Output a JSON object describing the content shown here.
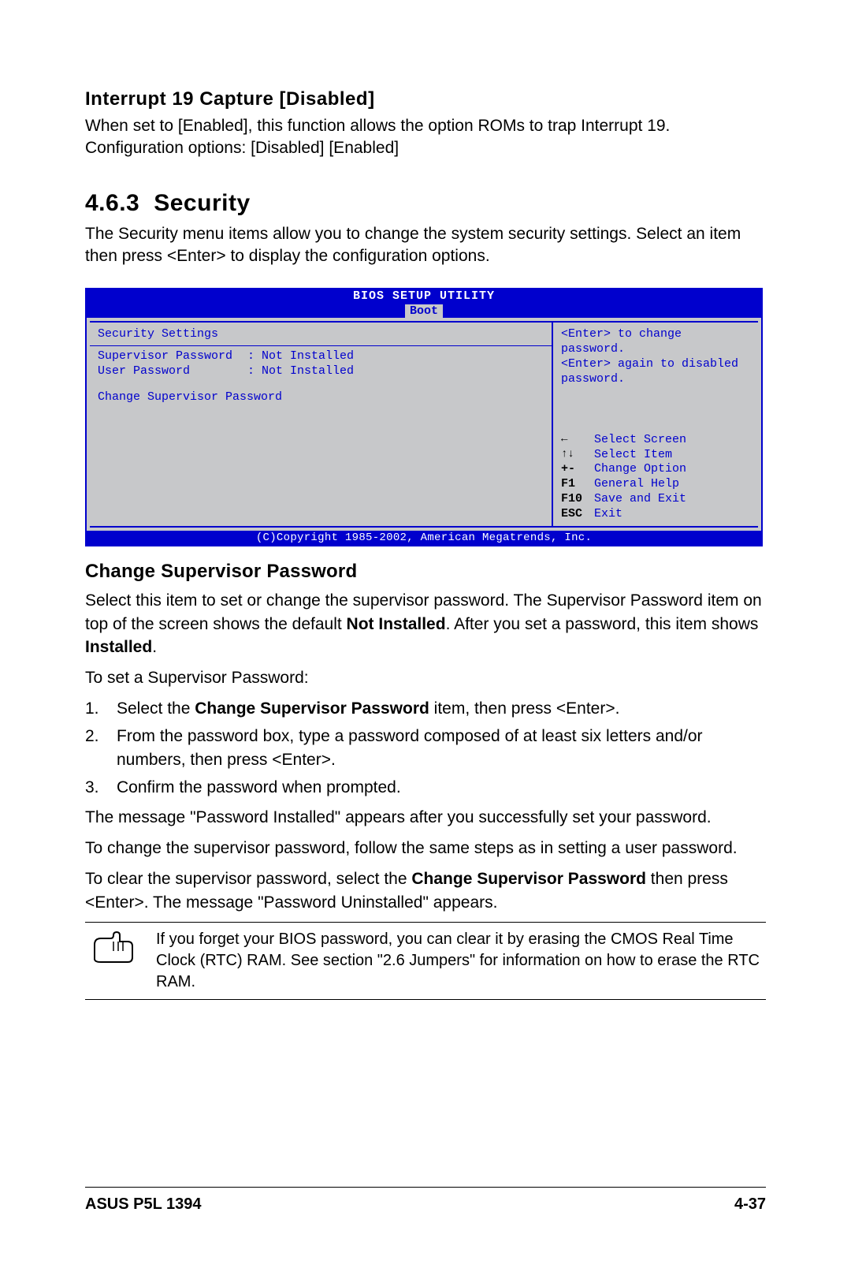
{
  "interrupt": {
    "heading": "Interrupt 19 Capture [Disabled]",
    "body": "When set to [Enabled], this function allows the option ROMs to trap Interrupt 19. Configuration options: [Disabled] [Enabled]"
  },
  "section": {
    "number": "4.6.3",
    "title": "Security",
    "intro": "The Security menu items allow you to change the system security settings. Select an item then press <Enter> to display the configuration options."
  },
  "bios": {
    "title": "BIOS SETUP UTILITY",
    "tab": "Boot",
    "left": {
      "section_title": "Security Settings",
      "rows": [
        {
          "label": "Supervisor Password",
          "value": "Not Installed"
        },
        {
          "label": "User Password",
          "value": "Not Installed"
        }
      ],
      "action": "Change Supervisor Password"
    },
    "right": {
      "help": "<Enter> to change password.\n<Enter> again to disabled password.",
      "keys": [
        {
          "key": "←",
          "desc": "Select Screen"
        },
        {
          "key": "↑↓",
          "desc": "Select Item"
        },
        {
          "key": "+-",
          "desc": "Change Option"
        },
        {
          "key": "F1",
          "desc": "General Help"
        },
        {
          "key": "F10",
          "desc": "Save and Exit"
        },
        {
          "key": "ESC",
          "desc": "Exit"
        }
      ]
    },
    "copyright": "(C)Copyright 1985-2002, American Megatrends, Inc."
  },
  "change_pw": {
    "heading": "Change Supervisor Password",
    "p1_pre": "Select this item to set or change the supervisor password. The Supervisor Password item on top of the screen shows the default ",
    "p1_b1": "Not Installed",
    "p1_mid": ". After you set a password, this item shows ",
    "p1_b2": "Installed",
    "p1_post": ".",
    "p2": "To set a Supervisor Password:",
    "steps": {
      "s1_pre": "Select the ",
      "s1_b": "Change Supervisor Password",
      "s1_post": " item, then press <Enter>.",
      "s2": "From the password box, type a password composed of at least six letters and/or numbers, then press <Enter>.",
      "s3": "Confirm the password when prompted."
    },
    "p3": "The message \"Password Installed\" appears after you successfully set your password.",
    "p4": "To change the supervisor password, follow the same steps as in setting a user password.",
    "p5_pre": "To clear the supervisor password, select the ",
    "p5_b": "Change Supervisor Password",
    "p5_post": " then press <Enter>. The message \"Password Uninstalled\" appears."
  },
  "note": "If you forget your BIOS password, you can clear it by erasing the CMOS Real Time Clock (RTC) RAM. See section \"2.6  Jumpers\" for information on how to erase the RTC RAM.",
  "footer": {
    "left": "ASUS P5L 1394",
    "right": "4-37"
  }
}
